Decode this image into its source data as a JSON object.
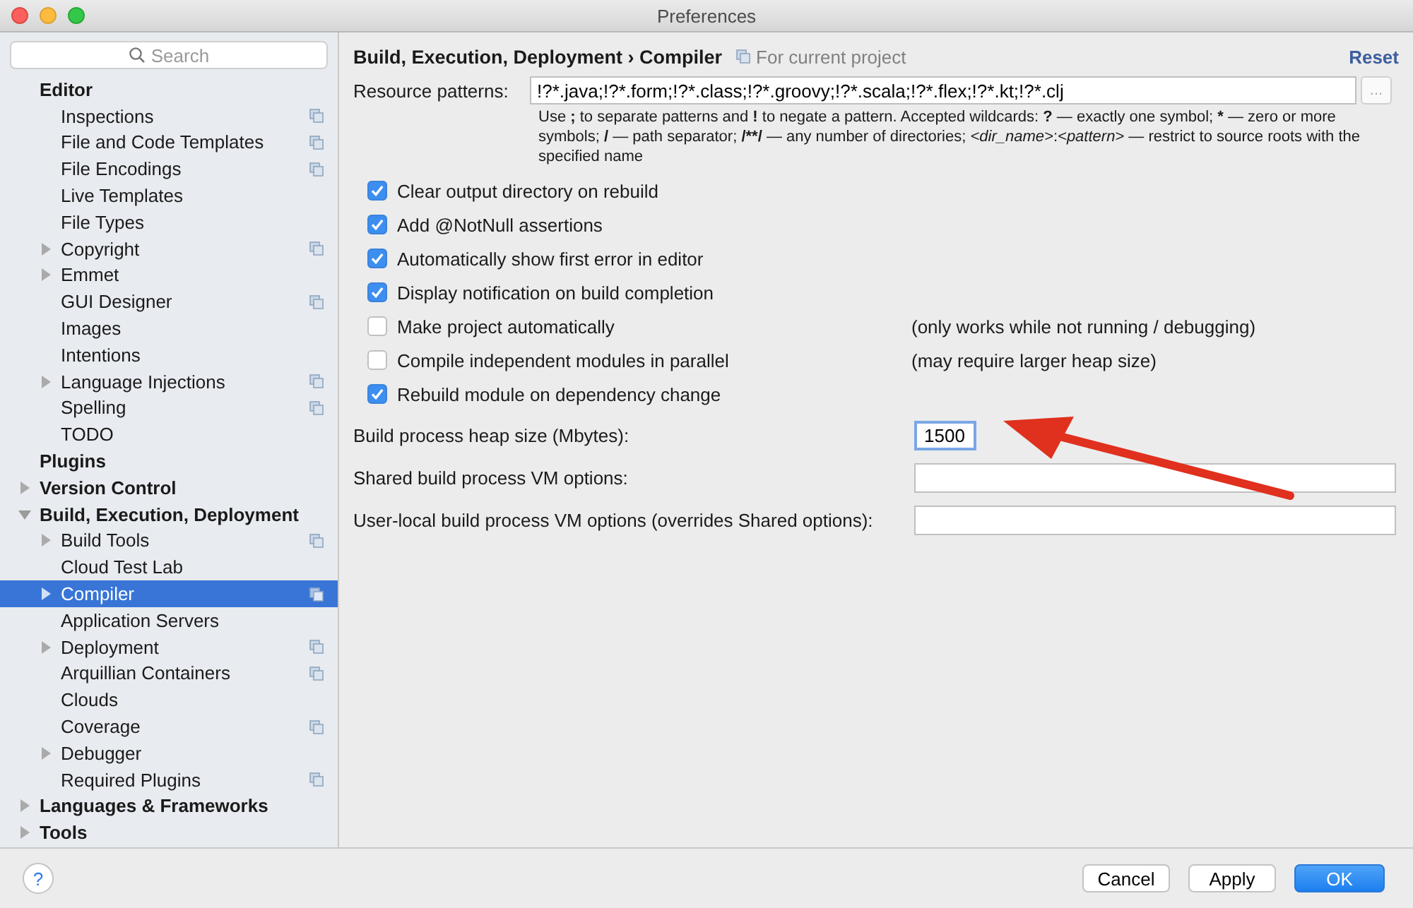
{
  "window": {
    "title": "Preferences"
  },
  "sidebar": {
    "search": {
      "placeholder": "Search"
    },
    "items": [
      {
        "label": "Editor",
        "selected": false,
        "shared": false,
        "children": [
          {
            "label": "Inspections",
            "selected": false,
            "shared": true
          },
          {
            "label": "File and Code Templates",
            "selected": false,
            "shared": true
          },
          {
            "label": "File Encodings",
            "selected": false,
            "shared": true
          },
          {
            "label": "Live Templates",
            "selected": false,
            "shared": false
          },
          {
            "label": "File Types",
            "selected": false,
            "shared": false
          },
          {
            "label": "Copyright",
            "selected": false,
            "shared": true,
            "expanded": false
          },
          {
            "label": "Emmet",
            "selected": false,
            "shared": false,
            "expanded": false
          },
          {
            "label": "GUI Designer",
            "selected": false,
            "shared": true
          },
          {
            "label": "Images",
            "selected": false,
            "shared": false
          },
          {
            "label": "Intentions",
            "selected": false,
            "shared": false
          },
          {
            "label": "Language Injections",
            "selected": false,
            "shared": true,
            "expanded": false
          },
          {
            "label": "Spelling",
            "selected": false,
            "shared": true
          },
          {
            "label": "TODO",
            "selected": false,
            "shared": false
          }
        ]
      },
      {
        "label": "Plugins",
        "selected": false,
        "shared": false
      },
      {
        "label": "Version Control",
        "selected": false,
        "shared": false,
        "expanded": false
      },
      {
        "label": "Build, Execution, Deployment",
        "selected": false,
        "shared": false,
        "expanded": true,
        "children": [
          {
            "label": "Build Tools",
            "selected": false,
            "shared": true,
            "expanded": false
          },
          {
            "label": "Cloud Test Lab",
            "selected": false,
            "shared": false
          },
          {
            "label": "Compiler",
            "selected": true,
            "shared": true,
            "expanded": false
          },
          {
            "label": "Application Servers",
            "selected": false,
            "shared": false
          },
          {
            "label": "Deployment",
            "selected": false,
            "shared": true,
            "expanded": false
          },
          {
            "label": "Arquillian Containers",
            "selected": false,
            "shared": true
          },
          {
            "label": "Clouds",
            "selected": false,
            "shared": false
          },
          {
            "label": "Coverage",
            "selected": false,
            "shared": true
          },
          {
            "label": "Debugger",
            "selected": false,
            "shared": false,
            "expanded": false
          },
          {
            "label": "Required Plugins",
            "selected": false,
            "shared": true
          }
        ]
      },
      {
        "label": "Languages & Frameworks",
        "selected": false,
        "shared": false,
        "expanded": false
      },
      {
        "label": "Tools",
        "selected": false,
        "shared": false,
        "expanded": false
      }
    ]
  },
  "header": {
    "breadcrumb": "Build, Execution, Deployment",
    "separator": "›",
    "page": "Compiler",
    "scope": "For current project",
    "reset": "Reset"
  },
  "resource_patterns": {
    "label": "Resource patterns:",
    "value": "!?*.java;!?*.form;!?*.class;!?*.groovy;!?*.scala;!?*.flex;!?*.kt;!?*.clj",
    "browse": "...",
    "hint": [
      {
        "text": "Use ",
        "kind": "prose"
      },
      {
        "text": ";",
        "kind": "symbol"
      },
      {
        "text": " to separate patterns and ",
        "kind": "prose"
      },
      {
        "text": "!",
        "kind": "symbol"
      },
      {
        "text": " to negate a pattern. Accepted wildcards: ",
        "kind": "prose"
      },
      {
        "text": "?",
        "kind": "symbol"
      },
      {
        "text": " — exactly one symbol; ",
        "kind": "prose"
      },
      {
        "text": "*",
        "kind": "symbol"
      },
      {
        "text": " — zero or more symbols; ",
        "kind": "prose"
      },
      {
        "text": "/",
        "kind": "symbol"
      },
      {
        "text": " — path separator; ",
        "kind": "prose"
      },
      {
        "text": "/**/",
        "kind": "symbol"
      },
      {
        "text": " — any number of directories; ",
        "kind": "prose"
      },
      {
        "text": "<dir_name>",
        "kind": "placeholder"
      },
      {
        "text": ":",
        "kind": "prose"
      },
      {
        "text": "<pattern>",
        "kind": "placeholder"
      },
      {
        "text": " — restrict to source roots with the specified name",
        "kind": "prose"
      }
    ]
  },
  "options": [
    {
      "label": "Clear output directory on rebuild",
      "checked": true
    },
    {
      "label": "Add @NotNull assertions",
      "checked": true
    },
    {
      "label": "Automatically show first error in editor",
      "checked": true
    },
    {
      "label": "Display notification on build completion",
      "checked": true
    },
    {
      "label": "Make project automatically",
      "checked": false,
      "note": "(only works while not running / debugging)"
    },
    {
      "label": "Compile independent modules in parallel",
      "checked": false,
      "note": "(may require larger heap size)"
    },
    {
      "label": "Rebuild module on dependency change",
      "checked": true
    }
  ],
  "fields": [
    {
      "label": "Build process heap size (Mbytes):",
      "value": "1500",
      "focused": true,
      "kind": "short"
    },
    {
      "label": "Shared build process VM options:",
      "focused": false,
      "kind": "wide"
    },
    {
      "label": "User-local build process VM options (overrides Shared options):",
      "focused": false,
      "kind": "wide"
    }
  ],
  "footer": {
    "help": "?",
    "buttons": [
      {
        "label": "Cancel",
        "default": false
      },
      {
        "label": "Apply",
        "default": false
      },
      {
        "label": "OK",
        "default": true
      }
    ]
  }
}
